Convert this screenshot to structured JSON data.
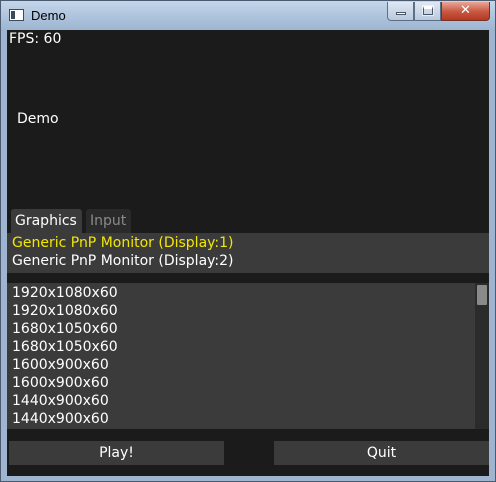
{
  "window": {
    "title": "Demo",
    "close_glyph": "✕"
  },
  "overlay": {
    "fps_text": "FPS: 60",
    "demo_text": "Demo"
  },
  "tabs": [
    {
      "label": "Graphics",
      "active": true
    },
    {
      "label": "Input",
      "active": false
    }
  ],
  "monitors": [
    {
      "label": "Generic PnP Monitor (Display:1)",
      "selected": true
    },
    {
      "label": "Generic PnP Monitor (Display:2)",
      "selected": false
    }
  ],
  "resolutions": [
    "1920x1080x60",
    "1920x1080x60",
    "1680x1050x60",
    "1680x1050x60",
    "1600x900x60",
    "1600x900x60",
    "1440x900x60",
    "1440x900x60"
  ],
  "buttons": {
    "play_label": "Play!",
    "quit_label": "Quit"
  },
  "colors": {
    "selected_text": "#f3e800",
    "panel_bg": "#3b3b3b",
    "client_bg": "#1b1b1b"
  },
  "icons": {
    "app": "app-window-icon",
    "minimize": "minimize-icon",
    "maximize": "maximize-icon",
    "close": "close-icon"
  }
}
